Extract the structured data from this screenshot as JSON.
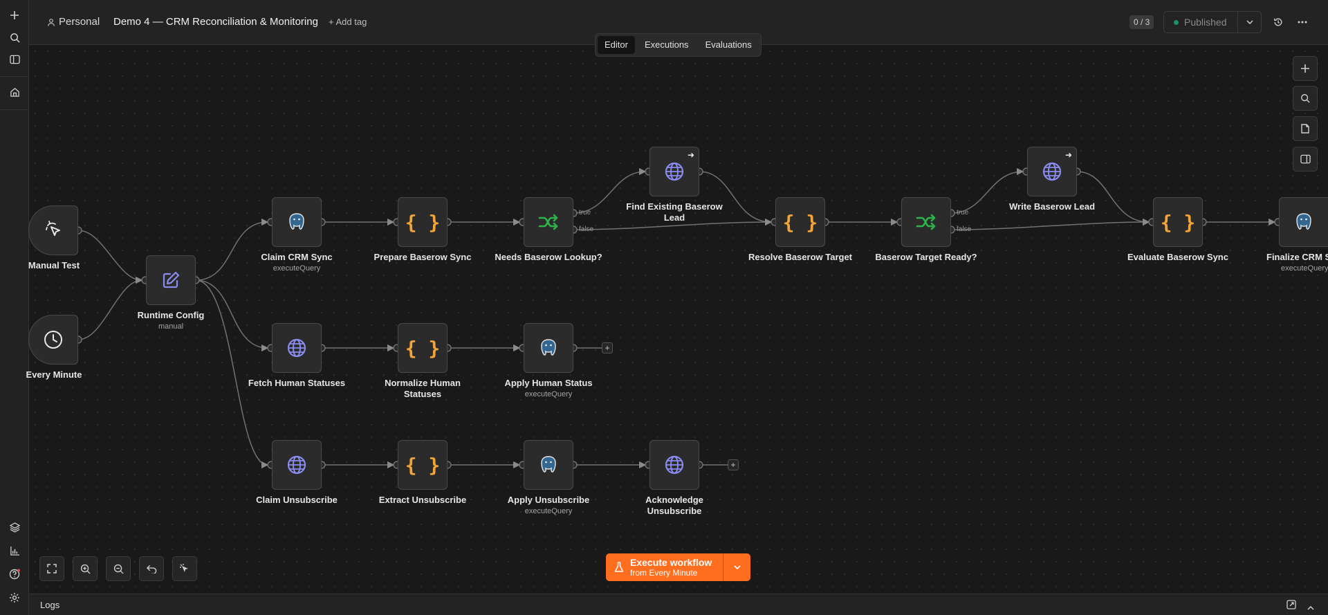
{
  "project": "Personal",
  "workflow_title": "Demo 4 — CRM Reconciliation & Monitoring",
  "add_tag": "+ Add tag",
  "counter": "0 / 3",
  "published": "Published",
  "tabs": [
    "Editor",
    "Executions",
    "Evaluations"
  ],
  "active_tab": "Editor",
  "colors": {
    "accent": "#ff6d1f",
    "code": "#f2a33a",
    "http": "#8b8cf0",
    "if": "#2db34a",
    "published_dot": "#1c8f6e"
  },
  "nodes": {
    "manual_test": {
      "label": "Manual Test",
      "icon": "cursor-click-icon"
    },
    "every_minute": {
      "label": "Every Minute",
      "icon": "clock-icon"
    },
    "runtime_config": {
      "label": "Runtime Config",
      "sub": "manual",
      "icon": "pencil-icon"
    },
    "claim_crm_sync": {
      "label": "Claim CRM Sync",
      "sub": "executeQuery",
      "icon": "postgres-icon"
    },
    "prepare_baserow_sync": {
      "label": "Prepare Baserow Sync",
      "icon": "code-icon"
    },
    "needs_baserow_lookup": {
      "label": "Needs Baserow Lookup?",
      "icon": "if-icon",
      "true": "true",
      "false": "false"
    },
    "find_existing_baserow_lead": {
      "label": "Find Existing Baserow Lead",
      "icon": "globe-icon"
    },
    "resolve_baserow_target": {
      "label": "Resolve Baserow Target",
      "icon": "code-icon"
    },
    "baserow_target_ready": {
      "label": "Baserow Target Ready?",
      "icon": "if-icon",
      "true": "true",
      "false": "false"
    },
    "write_baserow_lead": {
      "label": "Write Baserow Lead",
      "icon": "globe-icon"
    },
    "evaluate_baserow_sync": {
      "label": "Evaluate Baserow Sync",
      "icon": "code-icon"
    },
    "finalize_crm_sync": {
      "label": "Finalize CRM Sy",
      "sub": "executeQuery",
      "icon": "postgres-icon"
    },
    "fetch_human_statuses": {
      "label": "Fetch Human Statuses",
      "icon": "globe-icon"
    },
    "normalize_human_statuses": {
      "label": "Normalize Human Statuses",
      "icon": "code-icon"
    },
    "apply_human_status": {
      "label": "Apply Human Status",
      "sub": "executeQuery",
      "icon": "postgres-icon"
    },
    "claim_unsubscribe": {
      "label": "Claim Unsubscribe",
      "icon": "globe-icon"
    },
    "extract_unsubscribe": {
      "label": "Extract Unsubscribe",
      "icon": "code-icon"
    },
    "apply_unsubscribe": {
      "label": "Apply Unsubscribe",
      "sub": "executeQuery",
      "icon": "postgres-icon"
    },
    "acknowledge_unsubscribe": {
      "label": "Acknowledge Unsubscribe",
      "icon": "globe-icon"
    }
  },
  "execute": {
    "label": "Execute workflow",
    "sub": "from Every Minute"
  },
  "logs": "Logs"
}
